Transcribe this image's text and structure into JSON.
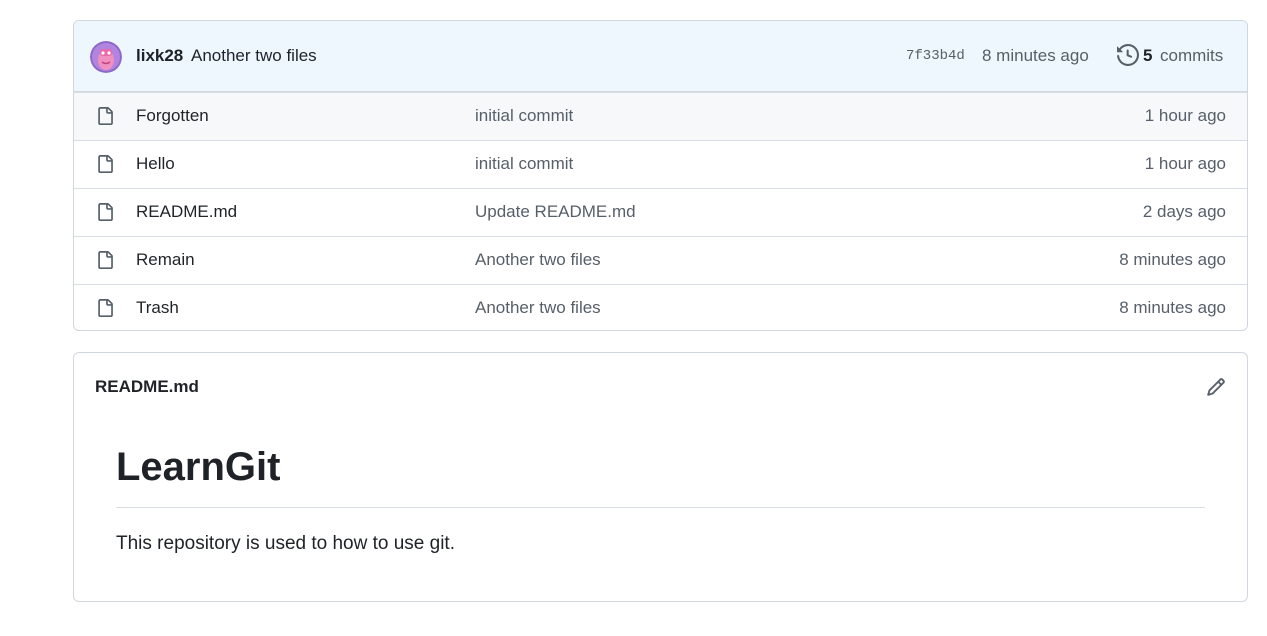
{
  "commit": {
    "author": "lixk28",
    "message": "Another two files",
    "sha": "7f33b4d",
    "time": "8 minutes ago",
    "count": "5",
    "count_label": "commits"
  },
  "files": [
    {
      "name": "Forgotten",
      "commit": "initial commit",
      "age": "1 hour ago"
    },
    {
      "name": "Hello",
      "commit": "initial commit",
      "age": "1 hour ago"
    },
    {
      "name": "README.md",
      "commit": "Update README.md",
      "age": "2 days ago"
    },
    {
      "name": "Remain",
      "commit": "Another two files",
      "age": "8 minutes ago"
    },
    {
      "name": "Trash",
      "commit": "Another two files",
      "age": "8 minutes ago"
    }
  ],
  "readme": {
    "filename": "README.md",
    "heading": "LearnGit",
    "paragraph": "This repository is used to how to use git."
  },
  "icons": {
    "file": "file-icon",
    "history": "history-icon",
    "edit": "pencil-icon",
    "avatar": "avatar"
  },
  "colors": {
    "commit_bar_bg": "#eef6fe",
    "border": "#d0d7de",
    "muted_text": "#57606a",
    "text": "#1f2328",
    "first_row_bg": "#f6f8fa"
  }
}
